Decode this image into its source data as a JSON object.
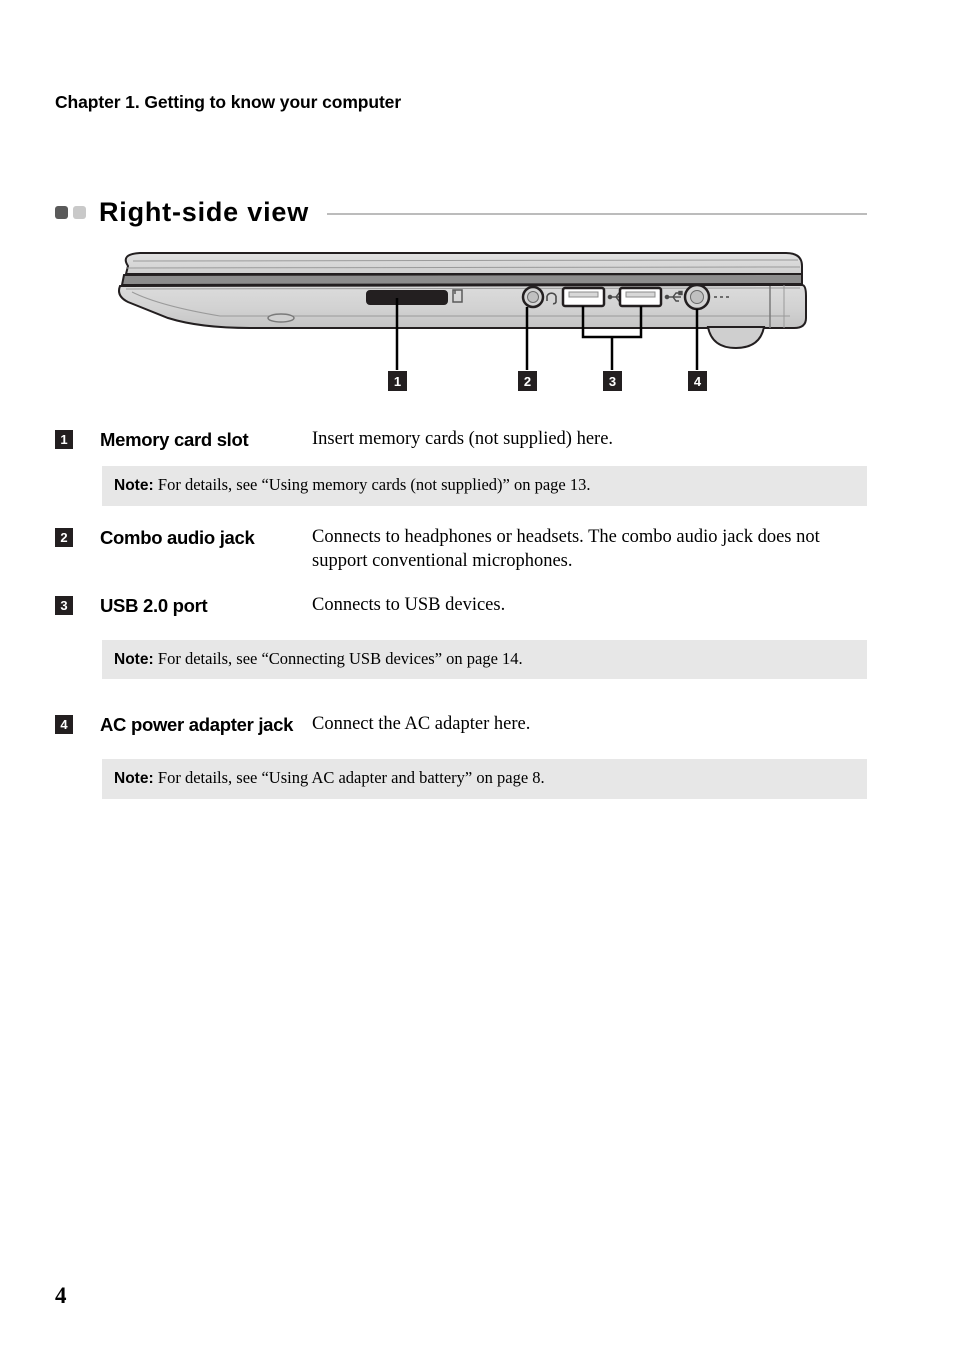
{
  "document": {
    "chapter_header": "Chapter 1. Getting to know your computer",
    "section_title": "Right-side view",
    "page_number": "4"
  },
  "figure": {
    "alt": "Right-side view of laptop showing ports",
    "callouts": [
      {
        "number": "1",
        "target": "memory-card-slot"
      },
      {
        "number": "2",
        "target": "combo-audio-jack"
      },
      {
        "number": "3",
        "target": "usb-2-0-ports"
      },
      {
        "number": "4",
        "target": "ac-power-adapter-jack"
      }
    ],
    "icons": [
      "memory-card-icon",
      "headset-icon",
      "usb-icon",
      "usb-icon",
      "power-icon"
    ]
  },
  "rows": [
    {
      "number": "1",
      "label": "Memory card slot",
      "description": "Insert memory cards (not supplied) here."
    },
    {
      "number": "2",
      "label": "Combo audio jack",
      "description": "Connects to headphones or headsets. The combo audio jack does not support conventional microphones."
    },
    {
      "number": "3",
      "label": "USB 2.0 port",
      "description": "Connects to USB devices."
    },
    {
      "number": "4",
      "label": "AC power adapter jack",
      "description": "Connect the AC adapter here."
    }
  ],
  "notes": {
    "note_label": "Note:",
    "memory_card": "For details, see “Using memory cards (not supplied)” on page 13.",
    "usb": "For details, see “Connecting USB devices” on page 14.",
    "ac_adapter": "For details, see “Using AC adapter and battery” on page 8."
  },
  "colors": {
    "badge_bg": "#231f20",
    "note_bg": "#e7e7e7",
    "rule": "#bcbcbc",
    "bullet_dark": "#5a5a5a",
    "bullet_light": "#c9c9c9"
  }
}
